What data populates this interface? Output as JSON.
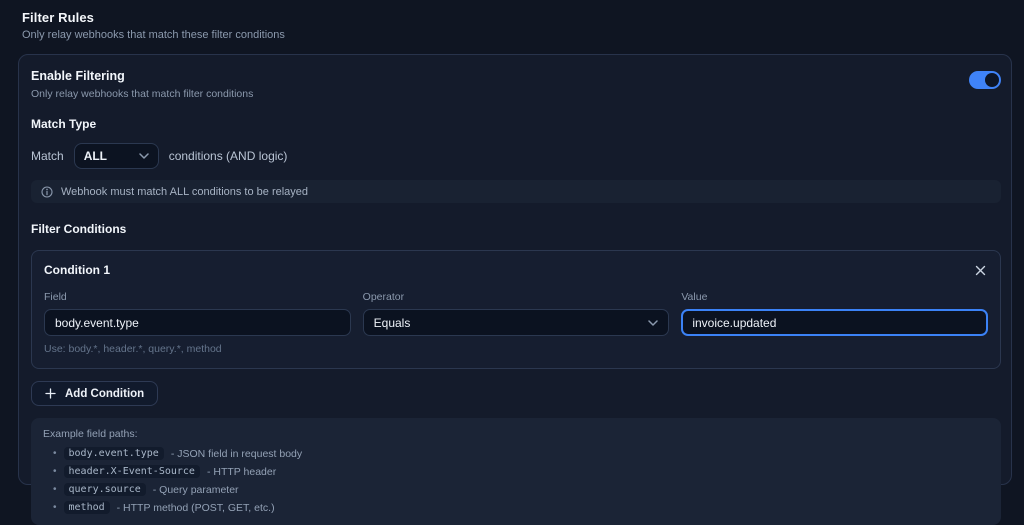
{
  "page": {
    "title": "Filter Rules",
    "subtitle": "Only relay webhooks that match these filter conditions"
  },
  "enable": {
    "title": "Enable Filtering",
    "subtitle": "Only relay webhooks that match filter conditions",
    "toggle_state": "on"
  },
  "match_type": {
    "heading": "Match Type",
    "prefix": "Match",
    "selected_option": "ALL",
    "suffix": "conditions (AND logic)",
    "info": "Webhook must match ALL conditions to be relayed"
  },
  "conditions": {
    "heading": "Filter Conditions",
    "card": {
      "title": "Condition 1",
      "field": {
        "label": "Field",
        "value": "body.event.type",
        "helper": "Use: body.*, header.*, query.*, method"
      },
      "operator": {
        "label": "Operator",
        "selected_option": "Equals"
      },
      "value": {
        "label": "Value",
        "value": "invoice.updated"
      }
    },
    "add_button_label": "Add Condition"
  },
  "examples": {
    "heading": "Example field paths:",
    "items": [
      {
        "code": "body.event.type",
        "desc": "- JSON field in request body"
      },
      {
        "code": "header.X-Event-Source",
        "desc": "- HTTP header"
      },
      {
        "code": "query.source",
        "desc": "- Query parameter"
      },
      {
        "code": "method",
        "desc": "- HTTP method (POST, GET, etc.)"
      }
    ]
  },
  "colors": {
    "accent_blue": "#3b82f6",
    "page_background": "#0f1522",
    "panel_background": "#141b2b"
  }
}
